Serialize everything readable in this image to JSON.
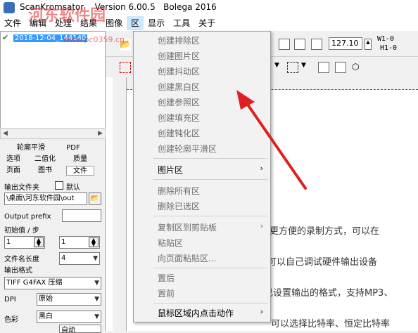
{
  "window": {
    "app_name": "ScanKromsator",
    "version": "Version 6.00.5",
    "author": "Bolega 2016"
  },
  "watermark": {
    "text": "河东软件园",
    "url_fragment": "www.pc0359.cn"
  },
  "menubar": [
    {
      "label": "文件"
    },
    {
      "label": "编辑"
    },
    {
      "label": "处理"
    },
    {
      "label": "结果"
    },
    {
      "label": "图像"
    },
    {
      "label": "区"
    },
    {
      "label": "显示"
    },
    {
      "label": "工具"
    },
    {
      "label": "关于"
    }
  ],
  "file_list": {
    "selected_file": "2018-12-04_144140"
  },
  "tabs": {
    "row1": [
      "轮廓平滑",
      "PDF"
    ],
    "row2": [
      "选项",
      "二值化",
      "质量"
    ],
    "row3": [
      "页面",
      "图书",
      "文件"
    ]
  },
  "output": {
    "folder_label": "输出文件夹",
    "default_label": "默认",
    "folder_path": "\\桌面\\河东软件园\\out",
    "prefix_label": "Output prefix",
    "start_step_label": "初始值 / 步",
    "start_value": "1",
    "step_value": "1",
    "name_length_label": "文件名长度",
    "name_length_value": "4",
    "format_label": "输出格式",
    "format_value": "TIFF G4FAX 压缩",
    "dpi_label": "DPI",
    "dpi_value": "原始",
    "color_label": "色彩",
    "color_value": "黑白",
    "last_label": "自动"
  },
  "toolbar": {
    "zoom": "127.10",
    "w_label": "W1-0",
    "h_label": "H1-0"
  },
  "context_menu": {
    "items": [
      {
        "label": "创建排除区",
        "enabled": false
      },
      {
        "label": "创建图片区",
        "enabled": false
      },
      {
        "label": "创建抖动区",
        "enabled": false
      },
      {
        "label": "创建黑白区",
        "enabled": false
      },
      {
        "label": "创建参照区",
        "enabled": false
      },
      {
        "label": "创建填充区",
        "enabled": false
      },
      {
        "label": "创建钝化区",
        "enabled": false
      },
      {
        "label": "创建轮廓平滑区",
        "enabled": false
      },
      {
        "label": "图片区",
        "enabled": true,
        "submenu": true
      },
      {
        "label": "删除所有区",
        "enabled": false
      },
      {
        "label": "删除已选区",
        "enabled": false
      },
      {
        "label": "复制区到剪贴板",
        "enabled": false,
        "submenu": true
      },
      {
        "label": "粘贴区",
        "enabled": false
      },
      {
        "label": "向页面粘贴区...",
        "enabled": false
      },
      {
        "label": "置后",
        "enabled": false
      },
      {
        "label": "置前",
        "enabled": false
      },
      {
        "label": "鼠标区域内点击动作",
        "enabled": true,
        "submenu": true
      }
    ]
  },
  "document_text": {
    "line1": "供更方便的录制方式，可以在",
    "line2": "可以自己调试硬件输出设备",
    "line3": "己设置输出的格式，支持MP3、",
    "line4": "可以选择比特率、恒定比特率"
  },
  "colors": {
    "accent": "#3399ff",
    "arrow": "#e02020",
    "menu_active": "#cce8ff"
  }
}
